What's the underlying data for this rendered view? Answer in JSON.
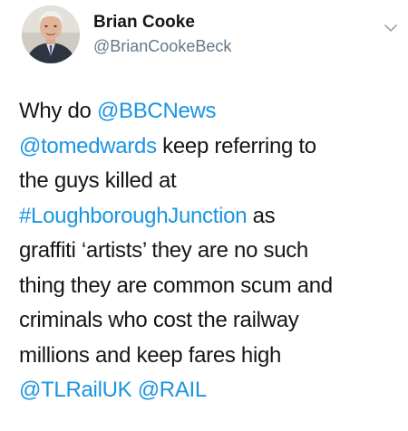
{
  "author": {
    "name": "Brian Cooke",
    "handle": "@BrianCookeBeck"
  },
  "colors": {
    "link": "#1b95e0",
    "text": "#14171a",
    "secondary": "#657786"
  },
  "icons": {
    "menu": "chevron-down-icon"
  },
  "tweet": {
    "line1": {
      "pre": "Why do ",
      "mention1": "@BBCNews"
    },
    "line2": {
      "mention2": "@tomedwards",
      "post": " keep referring to"
    },
    "line3": {
      "text": "the guys killed at"
    },
    "line4": {
      "hashtag": "#LoughboroughJunction",
      "post": " as"
    },
    "line5": {
      "text": "graffiti ‘artists’ they are no such"
    },
    "line6": {
      "text": "thing they are common scum and"
    },
    "line7": {
      "text": "criminals who cost the railway"
    },
    "line8": {
      "text": "millions and keep fares high"
    },
    "line9": {
      "mention3": "@TLRailUK",
      "sep": " ",
      "mention4": "@RAIL"
    }
  }
}
